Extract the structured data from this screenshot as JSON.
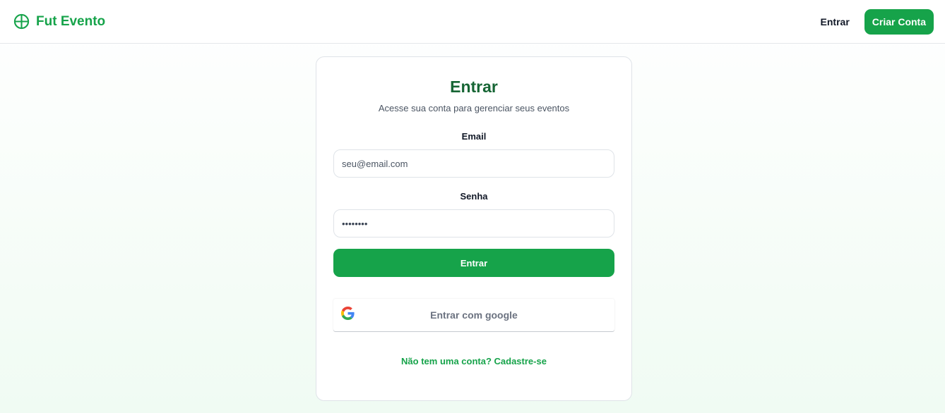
{
  "header": {
    "brand_name": "Fut Evento",
    "brand_icon": "globe-icon",
    "nav_login_label": "Entrar",
    "create_account_label": "Criar Conta"
  },
  "colors": {
    "brand_green": "#16a34a",
    "title_green": "#166534",
    "background_tint": "#f0fbf3"
  },
  "login": {
    "title": "Entrar",
    "subtitle": "Acesse sua conta para gerenciar seus eventos",
    "email_label": "Email",
    "email_placeholder": "seu@email.com",
    "password_label": "Senha",
    "password_value": "••••••••",
    "submit_label": "Entrar",
    "google_label": "Entrar com google",
    "google_icon": "google-icon",
    "signup_link": "Não tem uma conta? Cadastre-se"
  }
}
